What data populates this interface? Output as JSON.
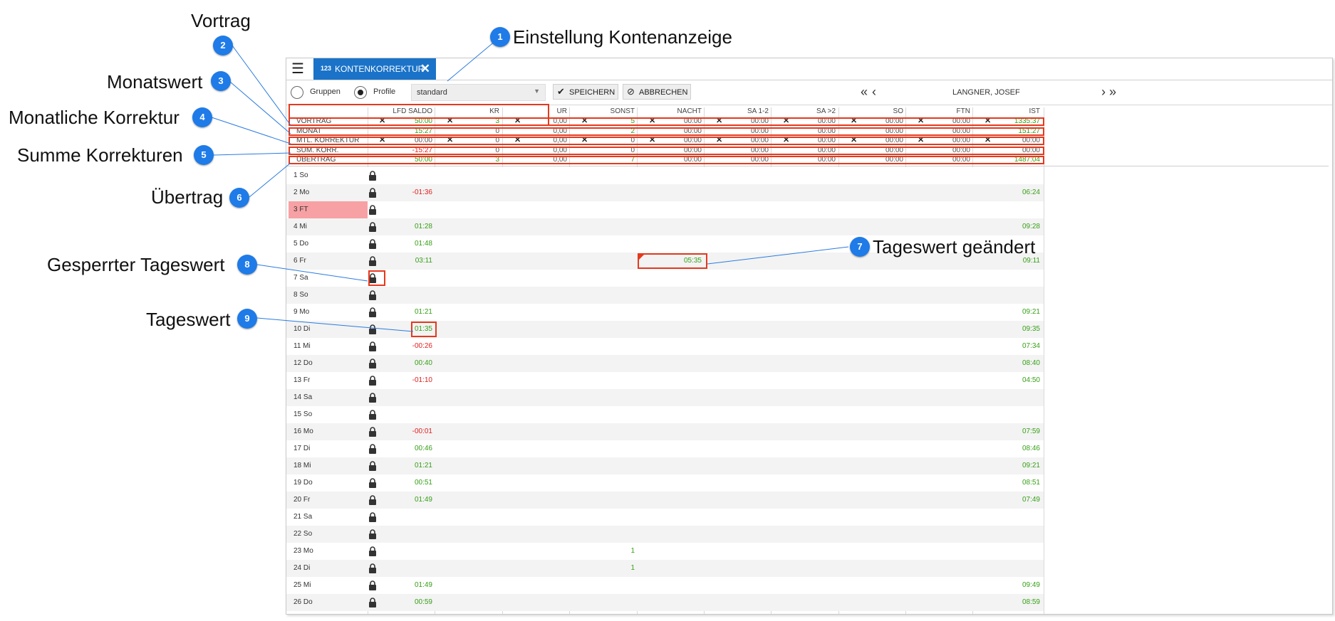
{
  "callouts": [
    {
      "n": "1",
      "text": "Einstellung Kontenanzeige"
    },
    {
      "n": "2",
      "text": "Vortrag"
    },
    {
      "n": "3",
      "text": "Monatswert"
    },
    {
      "n": "4",
      "text": "Monatliche Korrektur"
    },
    {
      "n": "5",
      "text": "Summe Korrekturen"
    },
    {
      "n": "6",
      "text": "Übertrag"
    },
    {
      "n": "7",
      "text": "Tageswert geändert"
    },
    {
      "n": "8",
      "text": "Gesperrter Tageswert"
    },
    {
      "n": "9",
      "text": "Tageswert"
    }
  ],
  "tab": {
    "icon": "123",
    "label": "KONTENKORREKTUR",
    "close_icon": "close-icon"
  },
  "toolbar": {
    "radio_groups_label": "Gruppen",
    "radio_profile_label": "Profile",
    "selected_radio": "Profile",
    "profile_value": "standard",
    "save_label": "SPEICHERN",
    "cancel_label": "ABBRECHEN",
    "employee": "LANGNER, JOSEF"
  },
  "columns": [
    "LFD SALDO",
    "KR",
    "UR",
    "SONST",
    "NACHT",
    "SA 1-2",
    "SA >2",
    "SO",
    "FTN",
    "IST"
  ],
  "summary_rows": [
    {
      "label": "VORTRAG",
      "has_x": true,
      "values": [
        "50:00",
        "3",
        "0,00",
        "5",
        "00:00",
        "00:00",
        "00:00",
        "00:00",
        "00:00",
        "1335:37"
      ],
      "colors": [
        "pos",
        "pos",
        "gray",
        "pos",
        "gray",
        "gray",
        "gray",
        "gray",
        "gray",
        "pos"
      ]
    },
    {
      "label": "MONAT",
      "has_x": false,
      "values": [
        "15:27",
        "0",
        "0,00",
        "2",
        "00:00",
        "00:00",
        "00:00",
        "00:00",
        "00:00",
        "151:27"
      ],
      "colors": [
        "pos",
        "gray",
        "gray",
        "pos",
        "gray",
        "gray",
        "gray",
        "gray",
        "gray",
        "pos"
      ]
    },
    {
      "label": "MTL. KORREKTUR",
      "has_x": true,
      "values": [
        "00:00",
        "0",
        "0,00",
        "0",
        "00:00",
        "00:00",
        "00:00",
        "00:00",
        "00:00",
        "00:00"
      ],
      "colors": [
        "gray",
        "gray",
        "gray",
        "gray",
        "gray",
        "gray",
        "gray",
        "gray",
        "gray",
        "gray"
      ]
    },
    {
      "label": "SUM. KORR.",
      "has_x": false,
      "values": [
        "-15:27",
        "0",
        "0,00",
        "0",
        "00:00",
        "00:00",
        "00:00",
        "00:00",
        "00:00",
        "00:00"
      ],
      "colors": [
        "neg",
        "gray",
        "gray",
        "gray",
        "gray",
        "gray",
        "gray",
        "gray",
        "gray",
        "gray"
      ]
    },
    {
      "label": "ÜBERTRAG",
      "has_x": false,
      "values": [
        "50:00",
        "3",
        "0,00",
        "7",
        "00:00",
        "00:00",
        "00:00",
        "00:00",
        "00:00",
        "1487:04"
      ],
      "colors": [
        "pos",
        "pos",
        "gray",
        "pos",
        "gray",
        "gray",
        "gray",
        "gray",
        "gray",
        "pos"
      ]
    }
  ],
  "days": [
    {
      "label": "1 So",
      "lfd": "",
      "sonst": "",
      "nacht": "",
      "ist": ""
    },
    {
      "label": "2 Mo",
      "lfd": "-01:36",
      "sonst": "",
      "nacht": "",
      "ist": "06:24"
    },
    {
      "label": "3 FT",
      "lfd": "",
      "sonst": "",
      "nacht": "",
      "ist": "",
      "holiday": true
    },
    {
      "label": "4 Mi",
      "lfd": "01:28",
      "sonst": "",
      "nacht": "",
      "ist": "09:28"
    },
    {
      "label": "5 Do",
      "lfd": "01:48",
      "sonst": "",
      "nacht": "",
      "ist": ""
    },
    {
      "label": "6 Fr",
      "lfd": "03:11",
      "sonst": "",
      "nacht": "05:35",
      "ist": "09:11"
    },
    {
      "label": "7 Sa",
      "lfd": "",
      "sonst": "",
      "nacht": "",
      "ist": ""
    },
    {
      "label": "8 So",
      "lfd": "",
      "sonst": "",
      "nacht": "",
      "ist": ""
    },
    {
      "label": "9 Mo",
      "lfd": "01:21",
      "sonst": "",
      "nacht": "",
      "ist": "09:21"
    },
    {
      "label": "10 Di",
      "lfd": "01:35",
      "sonst": "",
      "nacht": "",
      "ist": "09:35"
    },
    {
      "label": "11 Mi",
      "lfd": "-00:26",
      "sonst": "",
      "nacht": "",
      "ist": "07:34"
    },
    {
      "label": "12 Do",
      "lfd": "00:40",
      "sonst": "",
      "nacht": "",
      "ist": "08:40"
    },
    {
      "label": "13 Fr",
      "lfd": "-01:10",
      "sonst": "",
      "nacht": "",
      "ist": "04:50"
    },
    {
      "label": "14 Sa",
      "lfd": "",
      "sonst": "",
      "nacht": "",
      "ist": ""
    },
    {
      "label": "15 So",
      "lfd": "",
      "sonst": "",
      "nacht": "",
      "ist": ""
    },
    {
      "label": "16 Mo",
      "lfd": "-00:01",
      "sonst": "",
      "nacht": "",
      "ist": "07:59"
    },
    {
      "label": "17 Di",
      "lfd": "00:46",
      "sonst": "",
      "nacht": "",
      "ist": "08:46"
    },
    {
      "label": "18 Mi",
      "lfd": "01:21",
      "sonst": "",
      "nacht": "",
      "ist": "09:21"
    },
    {
      "label": "19 Do",
      "lfd": "00:51",
      "sonst": "",
      "nacht": "",
      "ist": "08:51"
    },
    {
      "label": "20 Fr",
      "lfd": "01:49",
      "sonst": "",
      "nacht": "",
      "ist": "07:49"
    },
    {
      "label": "21 Sa",
      "lfd": "",
      "sonst": "",
      "nacht": "",
      "ist": ""
    },
    {
      "label": "22 So",
      "lfd": "",
      "sonst": "",
      "nacht": "",
      "ist": ""
    },
    {
      "label": "23 Mo",
      "lfd": "",
      "sonst": "1",
      "nacht": "",
      "ist": ""
    },
    {
      "label": "24 Di",
      "lfd": "",
      "sonst": "1",
      "nacht": "",
      "ist": ""
    },
    {
      "label": "25 Mi",
      "lfd": "01:49",
      "sonst": "",
      "nacht": "",
      "ist": "09:49"
    },
    {
      "label": "26 Do",
      "lfd": "00:59",
      "sonst": "",
      "nacht": "",
      "ist": "08:59"
    }
  ],
  "colors": {
    "accent": "#1a73c8",
    "badge": "#1e7be8",
    "highlight": "#e5391e",
    "positive": "#36a017",
    "negative": "#e32020",
    "holiday": "#f7a1a4"
  }
}
